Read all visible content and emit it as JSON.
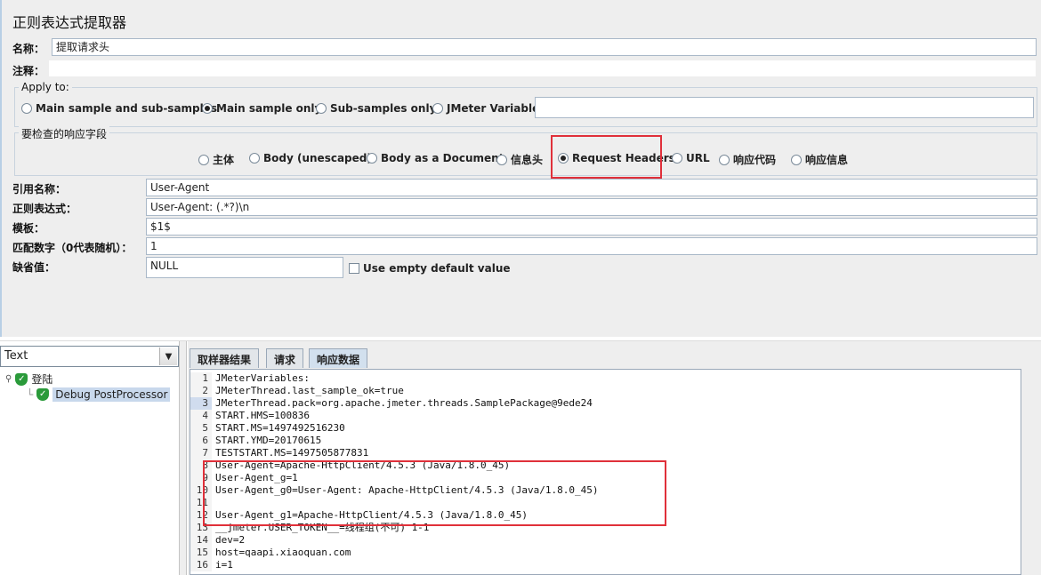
{
  "panel_title": "正则表达式提取器",
  "name_row": {
    "label": "名称：",
    "value": "提取请求头"
  },
  "comment_row": {
    "label": "注释：",
    "value": ""
  },
  "apply_to": {
    "legend": "Apply to:",
    "options": [
      {
        "label": "Main sample and sub-samples",
        "selected": false
      },
      {
        "label": "Main sample only",
        "selected": true
      },
      {
        "label": "Sub-samples only",
        "selected": false
      },
      {
        "label": "JMeter Variable",
        "selected": false
      }
    ],
    "variable_value": ""
  },
  "response_field": {
    "legend": "要检查的响应字段",
    "options": [
      {
        "label": "主体",
        "selected": false
      },
      {
        "label": "Body (unescaped)",
        "selected": false
      },
      {
        "label": "Body as a Document",
        "selected": false
      },
      {
        "label": "信息头",
        "selected": false
      },
      {
        "label": "Request Headers",
        "selected": true
      },
      {
        "label": "URL",
        "selected": false
      },
      {
        "label": "响应代码",
        "selected": false
      },
      {
        "label": "响应信息",
        "selected": false
      }
    ]
  },
  "fields": {
    "ref_name": {
      "label": "引用名称：",
      "value": "User-Agent"
    },
    "regex": {
      "label": "正则表达式：",
      "value": "User-Agent: (.*?)\\n"
    },
    "template": {
      "label": "模板：",
      "value": "$1$"
    },
    "match_no": {
      "label": "匹配数字（0代表随机）：",
      "value": "1"
    },
    "default_value": {
      "label": "缺省值：",
      "value": "NULL"
    },
    "use_empty_default": {
      "label": "Use empty default value",
      "checked": false
    }
  },
  "view_select": {
    "value": "Text"
  },
  "tree": {
    "root": "登陆",
    "child": "Debug PostProcessor"
  },
  "tabs": [
    "取样器结果",
    "请求",
    "响应数据"
  ],
  "active_tab": 2,
  "code_lines": [
    {
      "n": "1",
      "text": "JMeterVariables:"
    },
    {
      "n": "2",
      "text": "JMeterThread.last_sample_ok=true"
    },
    {
      "n": "3",
      "text": "JMeterThread.pack=org.apache.jmeter.threads.SamplePackage@9ede24"
    },
    {
      "n": "4",
      "text": "START.HMS=100836"
    },
    {
      "n": "5",
      "text": "START.MS=1497492516230"
    },
    {
      "n": "6",
      "text": "START.YMD=20170615"
    },
    {
      "n": "7",
      "text": "TESTSTART.MS=1497505877831"
    },
    {
      "n": "8",
      "text": "User-Agent=Apache-HttpClient/4.5.3 (Java/1.8.0_45)"
    },
    {
      "n": "9",
      "text": "User-Agent_g=1"
    },
    {
      "n": "10",
      "text": "User-Agent_g0=User-Agent: Apache-HttpClient/4.5.3 (Java/1.8.0_45)"
    },
    {
      "n": "11",
      "text": ""
    },
    {
      "n": "12",
      "text": "User-Agent_g1=Apache-HttpClient/4.5.3 (Java/1.8.0_45)"
    },
    {
      "n": "13",
      "text": "__jmeter.USER_TOKEN__=线程组(不可) 1-1"
    },
    {
      "n": "14",
      "text": "dev=2"
    },
    {
      "n": "15",
      "text": "host=qaapi.xiaoquan.com"
    },
    {
      "n": "16",
      "text": "i=1"
    }
  ],
  "current_line": 3,
  "colors": {
    "highlight": "#e0303a",
    "selection": "#c8d8ec"
  }
}
